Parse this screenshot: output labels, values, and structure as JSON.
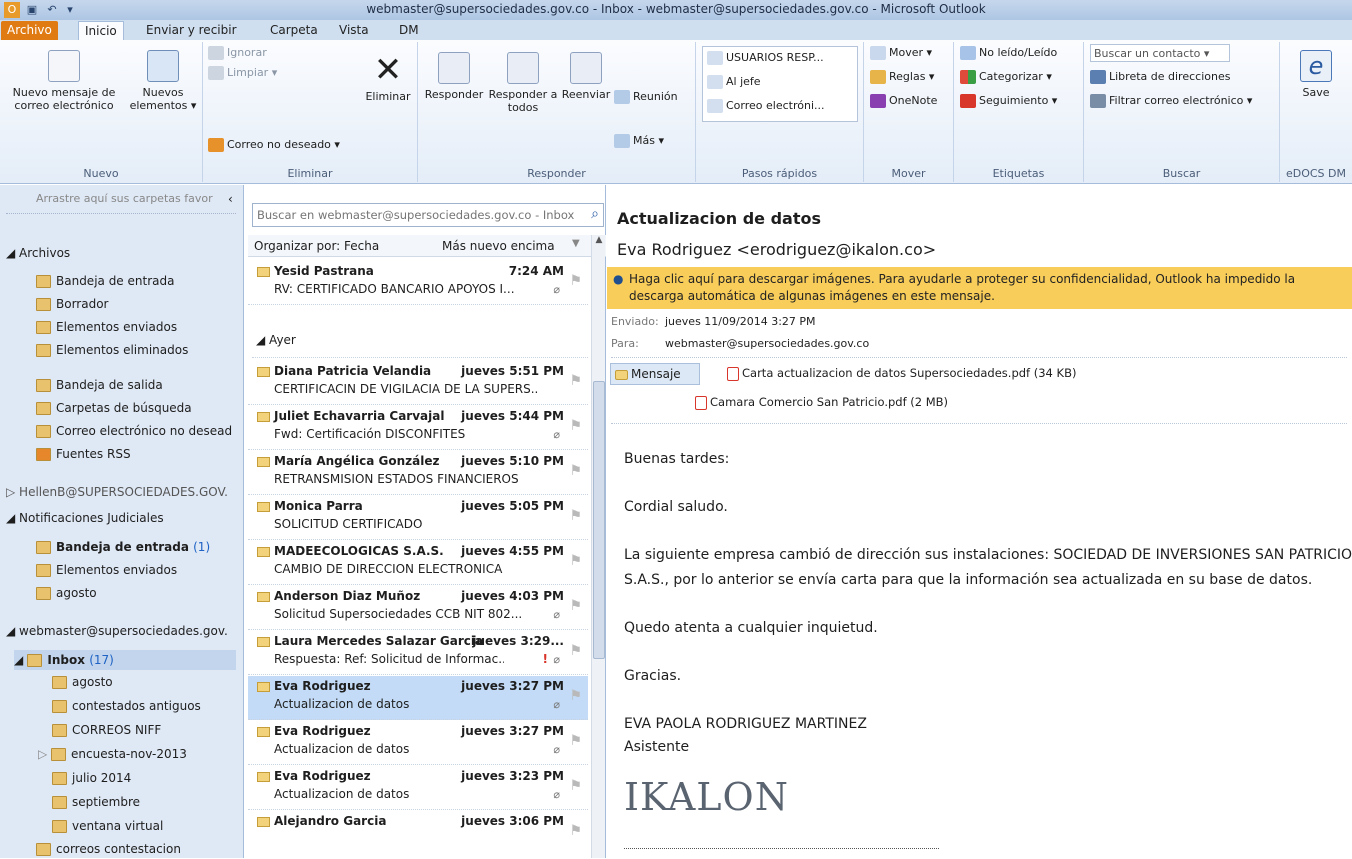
{
  "window": {
    "title": "webmaster@supersociedades.gov.co - Inbox - webmaster@supersociedades.gov.co - Microsoft Outlook"
  },
  "tabs": [
    "Archivo",
    "Inicio",
    "Enviar y recibir",
    "Carpeta",
    "Vista",
    "DM"
  ],
  "ribbon": {
    "nuevo": {
      "label": "Nuevo",
      "new_mail": "Nuevo mensaje de correo electrónico",
      "new_items": "Nuevos elementos ▾"
    },
    "eliminar": {
      "label": "Eliminar",
      "ignore": "Ignorar",
      "clean": "Limpiar ▾",
      "junk": "Correo no deseado ▾",
      "delete": "Eliminar"
    },
    "responder": {
      "label": "Responder",
      "reply": "Responder",
      "reply_all": "Responder a todos",
      "forward": "Reenviar",
      "meeting": "Reunión",
      "more": "Más ▾"
    },
    "pasos": {
      "label": "Pasos rápidos",
      "items": [
        "USUARIOS RESP...",
        "Al jefe",
        "Correo electróni..."
      ]
    },
    "mover": {
      "label": "Mover",
      "move": "Mover ▾",
      "rules": "Reglas ▾",
      "onenote": "OneNote"
    },
    "etiquetas": {
      "label": "Etiquetas",
      "unread": "No leído/Leído",
      "categorize": "Categorizar ▾",
      "followup": "Seguimiento ▾"
    },
    "buscar": {
      "label": "Buscar",
      "contact": "Buscar un contacto ▾",
      "addressbook": "Libreta de direcciones",
      "filter": "Filtrar correo electrónico ▾"
    },
    "edocs": {
      "label": "eDOCS DM",
      "save": "Save"
    }
  },
  "nav": {
    "favorites_hint": "Arrastre aquí sus carpetas favor",
    "archivos": "Archivos",
    "archivos_items": [
      "Bandeja de entrada",
      "Borrador",
      "Elementos enviados",
      "Elementos eliminados",
      "Bandeja de salida",
      "Carpetas de búsqueda",
      "Correo electrónico no desead",
      "Fuentes RSS"
    ],
    "hellen": "HellenB@SUPERSOCIEDADES.GOV.",
    "notif": "Notificaciones  Judiciales",
    "notif_inbox": "Bandeja de entrada",
    "notif_inbox_count": "(1)",
    "notif_items": [
      "Elementos enviados",
      "agosto"
    ],
    "webmaster": "webmaster@supersociedades.gov.",
    "inbox": "Inbox",
    "inbox_count": "(17)",
    "inbox_items": [
      "agosto",
      "contestados antiguos",
      "CORREOS NIFF",
      "encuesta-nov-2013",
      "julio 2014",
      "septiembre",
      "ventana virtual",
      "correos contestacion"
    ]
  },
  "list": {
    "search_placeholder": "Buscar en webmaster@supersociedades.gov.co - Inbox (",
    "sort_by": "Organizar por: Fecha",
    "sort_order": "Más nuevo encima",
    "group_yesterday": "Ayer",
    "messages": [
      {
        "from": "Yesid  Pastrana",
        "date": "7:24 AM",
        "subject": "RV: CERTIFICADO BANCARIO APOYOS I..."
      },
      {
        "from": "Diana Patricia Velandia",
        "date": "jueves 5:51 PM",
        "subject": "CERTIFICACIN DE VIGILACIA DE LA SUPERS..."
      },
      {
        "from": "Juliet Echavarria Carvajal",
        "date": "jueves 5:44 PM",
        "subject": "Fwd: Certificación DISCONFITES"
      },
      {
        "from": "María Angélica González",
        "date": "jueves 5:10 PM",
        "subject": "RETRANSMISION ESTADOS FINANCIEROS"
      },
      {
        "from": "Monica Parra",
        "date": "jueves 5:05 PM",
        "subject": "SOLICITUD CERTIFICADO"
      },
      {
        "from": "MADEECOLOGICAS S.A.S.",
        "date": "jueves 4:55 PM",
        "subject": "CAMBIO DE DIRECCION ELECTRONICA"
      },
      {
        "from": "Anderson Diaz Muñoz",
        "date": "jueves 4:03 PM",
        "subject": "Solicitud Supersociedades CCB NIT 802..."
      },
      {
        "from": "Laura Mercedes Salazar Garcia",
        "date": "jueves 3:29...",
        "subject": "Respuesta: Ref: Solicitud de Informac..."
      },
      {
        "from": "Eva Rodriguez",
        "date": "jueves 3:27 PM",
        "subject": "Actualizacion de datos"
      },
      {
        "from": "Eva Rodriguez",
        "date": "jueves 3:27 PM",
        "subject": "Actualizacion de datos"
      },
      {
        "from": "Eva Rodriguez",
        "date": "jueves 3:23 PM",
        "subject": "Actualizacion de datos"
      },
      {
        "from": "Alejandro Garcia",
        "date": "jueves 3:06 PM",
        "subject": ""
      }
    ]
  },
  "reading": {
    "subject": "Actualizacion de datos",
    "sender": "Eva Rodriguez <erodriguez@ikalon.co>",
    "infobar": "Haga clic aquí para descargar imágenes. Para ayudarle a proteger su confidencialidad, Outlook ha impedido la descarga automática de algunas imágenes en este mensaje.",
    "sent_label": "Enviado:",
    "sent_value": "jueves 11/09/2014 3:27 PM",
    "to_label": "Para:",
    "to_value": "webmaster@supersociedades.gov.co",
    "message_tab": "Mensaje",
    "attachments": [
      "Carta actualizacion de datos Supersociedades.pdf (34 KB)",
      "Camara Comercio San Patricio.pdf (2 MB)"
    ],
    "body": [
      "Buenas tardes:",
      "Cordial saludo.",
      "La siguiente empresa cambió de dirección sus instalaciones: SOCIEDAD DE INVERSIONES SAN PATRICIO",
      "S.A.S., por lo anterior se envía carta para que la información sea actualizada en su base de datos.",
      "Quedo atenta a cualquier inquietud.",
      "Gracias.",
      "EVA PAOLA RODRIGUEZ MARTINEZ",
      "Asistente"
    ],
    "logo": "IKALON"
  }
}
